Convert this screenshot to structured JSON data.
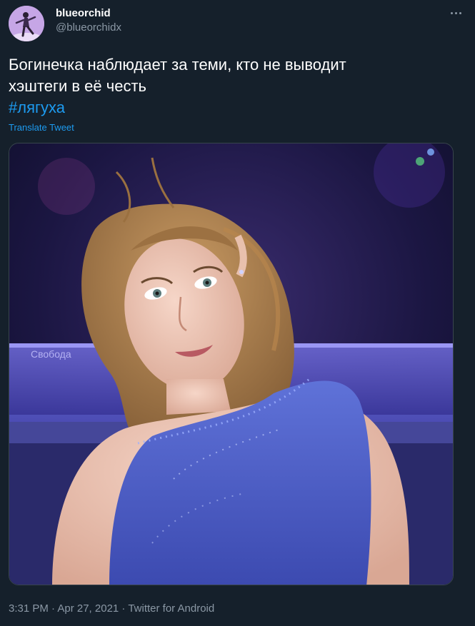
{
  "author": {
    "display_name": "blueorchid",
    "handle": "@blueorchidx",
    "avatar_icon": "skater-avatar"
  },
  "tweet": {
    "text_line1": "Богинечка наблюдает за теми, кто не выводит",
    "text_line2": "хэштеги в её честь",
    "hashtag": "#лягуха",
    "translate_label": "Translate Tweet",
    "timestamp": "3:31 PM · Apr 27, 2021 · Twitter for Android"
  },
  "media": {
    "sign_text": "Свобода"
  },
  "colors": {
    "background": "#15202b",
    "link": "#1d9bf0",
    "secondary_text": "#8b98a5"
  },
  "icons": {
    "more": "more-horizontal-icon"
  }
}
